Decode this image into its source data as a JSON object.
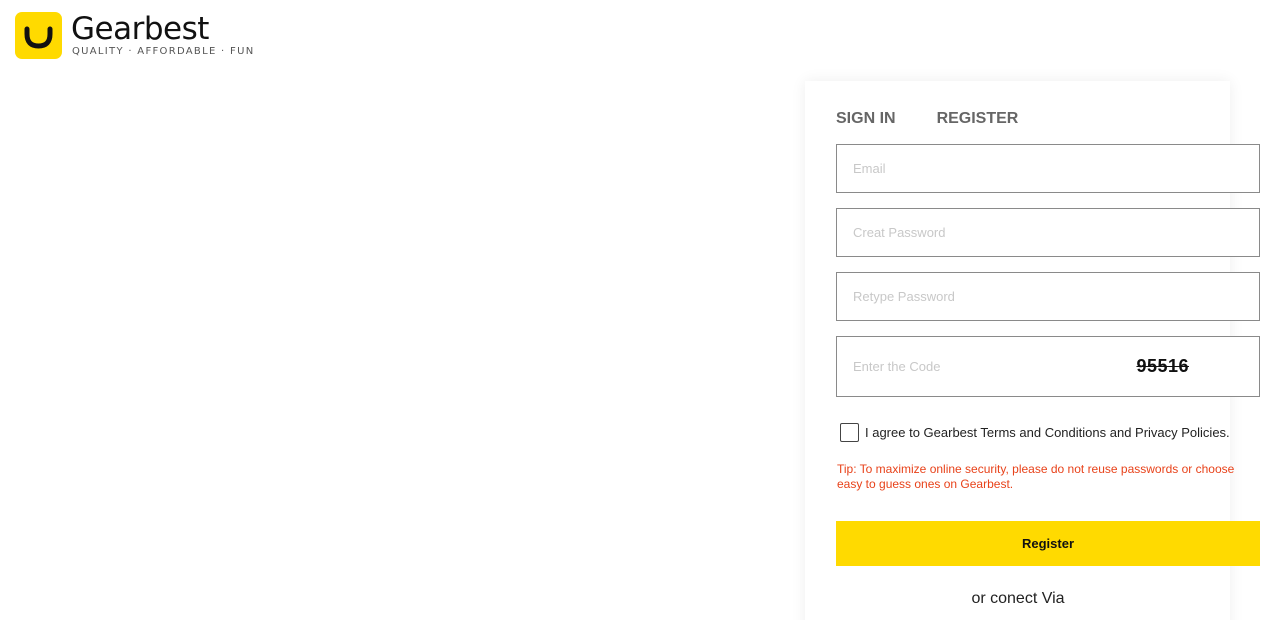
{
  "brand": {
    "name": "Gearbest",
    "tagline": "QUALITY · AFFORDABLE · FUN",
    "accent_color": "#ffda00"
  },
  "tabs": [
    {
      "label": "SIGN IN"
    },
    {
      "label": "REGISTER"
    }
  ],
  "form": {
    "email": {
      "placeholder": "Email",
      "value": ""
    },
    "password": {
      "placeholder": "Creat Password",
      "value": ""
    },
    "retype": {
      "placeholder": "Retype Password",
      "value": ""
    },
    "code": {
      "placeholder": "Enter the Code",
      "value": "",
      "captcha": "95516"
    },
    "agree_label": "I agree to Gearbest Terms and Conditions and Privacy Policies.",
    "tip": "Tip: To maximize online security, please do not reuse passwords or choose easy to guess ones on Gearbest.",
    "submit_label": "Register",
    "connect_label": "or conect Via",
    "tip_color": "#e8421a"
  }
}
